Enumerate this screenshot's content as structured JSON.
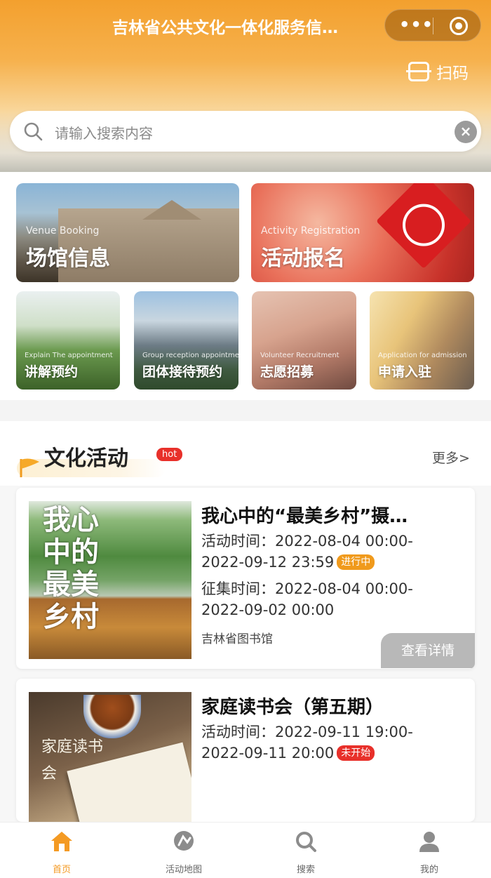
{
  "header": {
    "title": "吉林省公共文化一体化服务信…",
    "capsule_more": "•••",
    "scan_label": "扫码"
  },
  "search": {
    "placeholder": "请输入搜索内容",
    "clear_icon": "×"
  },
  "services": {
    "tiles": [
      {
        "cn": "场馆信息",
        "en": "Venue Booking"
      },
      {
        "cn": "活动报名",
        "en": "Activity Registration"
      },
      {
        "cn": "讲解预约",
        "en": "Explain The appointment"
      },
      {
        "cn": "团体接待预约",
        "en": "Group reception appointment"
      },
      {
        "cn": "志愿招募",
        "en": "Volunteer Recruitment"
      },
      {
        "cn": "申请入驻",
        "en": "Application for admission"
      }
    ]
  },
  "section": {
    "title": "文化活动",
    "badge": "hot",
    "more": "更多>"
  },
  "activities": [
    {
      "title": "我心中的“最美乡村”摄…",
      "poem": "我心中的最美乡村",
      "time_label": "活动时间：",
      "time_line1": "2022-08-04 00:00-",
      "time_line2": "2022-09-12 23:59",
      "status": "进行中",
      "collect_label": "征集时间：",
      "collect_line1": "2022-08-04 00:00-",
      "collect_line2": "2022-09-02 00:00",
      "venue": "吉林省图书馆",
      "detail_button": "查看详情"
    },
    {
      "title": "家庭读书会（第五期）",
      "poem": "家庭读书会",
      "time_label": "活动时间：",
      "time_line1": "2022-09-11 19:00-",
      "time_line2": "2022-09-11 20:00",
      "status": "未开始"
    }
  ],
  "tabbar": {
    "items": [
      {
        "label": "首页",
        "icon": "home-icon",
        "active": true
      },
      {
        "label": "活动地图",
        "icon": "map-icon",
        "active": false
      },
      {
        "label": "搜索",
        "icon": "search-icon",
        "active": false
      },
      {
        "label": "我的",
        "icon": "user-icon",
        "active": false
      }
    ]
  },
  "colors": {
    "primary": "#f49a23",
    "hot": "#e8302a",
    "status_going": "#f09a1c",
    "status_not_started": "#e8302a"
  }
}
